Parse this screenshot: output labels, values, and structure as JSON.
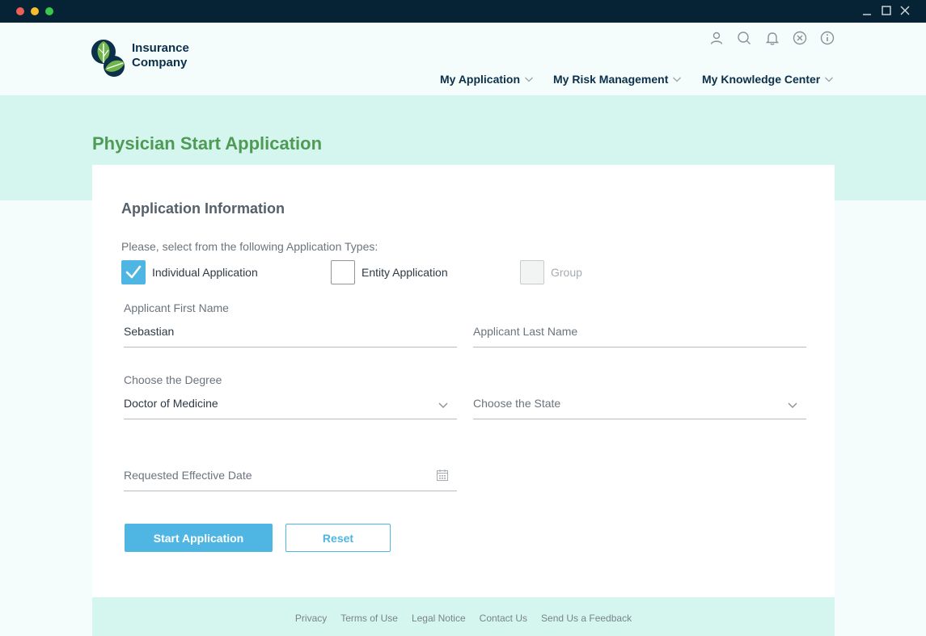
{
  "brand": {
    "name_line1": "Insurance",
    "name_line2": "Company",
    "colors": {
      "navy": "#0c2f4a",
      "green": "#4f9a54",
      "accent": "#4fb6e3",
      "mint": "#d5f6ef"
    }
  },
  "window_controls": [
    "minimize-icon",
    "maximize-icon",
    "close-icon"
  ],
  "header": {
    "top_icons": [
      "user-icon",
      "search-icon",
      "bell-icon",
      "close-circle-icon",
      "info-icon"
    ],
    "nav": [
      {
        "label": "My Application",
        "icon": "chevron-down-icon"
      },
      {
        "label": "My Risk Management",
        "icon": "chevron-down-icon"
      },
      {
        "label": "My Knowledge Center",
        "icon": "chevron-down-icon"
      }
    ]
  },
  "page": {
    "title": "Physician Start Application"
  },
  "form": {
    "section_title": "Application Information",
    "types_prompt": "Please, select from the following Application Types:",
    "types": [
      {
        "label": "Individual Application",
        "checked": true,
        "disabled": false
      },
      {
        "label": "Entity Application",
        "checked": false,
        "disabled": false
      },
      {
        "label": "Group",
        "checked": false,
        "disabled": true
      }
    ],
    "first_name": {
      "label": "Applicant First Name",
      "value": "Sebastian"
    },
    "last_name": {
      "placeholder": "Applicant Last Name"
    },
    "degree": {
      "label": "Choose the Degree",
      "value": "Doctor of Medicine"
    },
    "state": {
      "placeholder": "Choose the State"
    },
    "effective_date": {
      "placeholder": "Requested Effective Date",
      "icon": "calendar-icon"
    },
    "start_button": "Start Application",
    "reset_button": "Reset"
  },
  "footer": {
    "links": [
      "Privacy",
      "Terms of Use",
      "Legal Notice",
      "Contact Us",
      "Send Us a Feedback"
    ]
  }
}
